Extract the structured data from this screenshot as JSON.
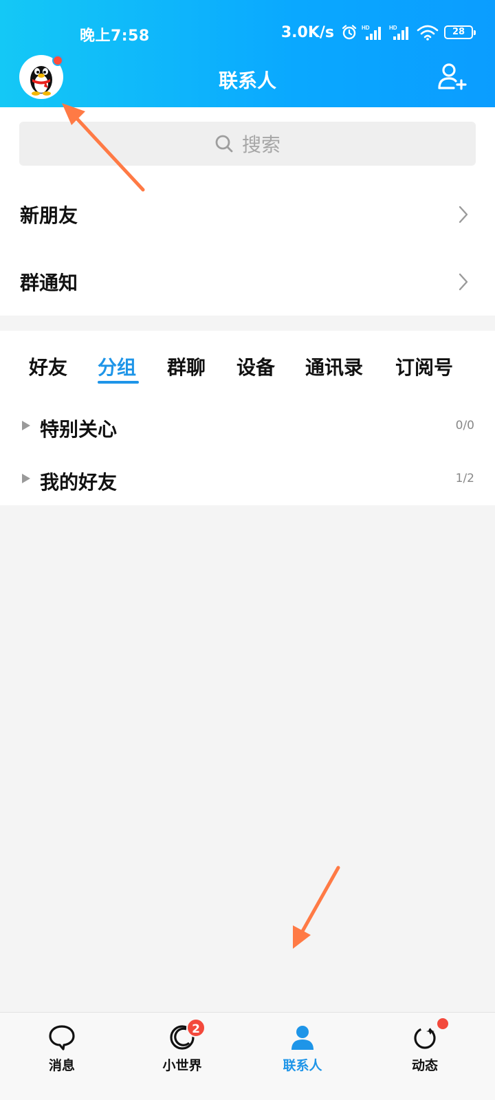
{
  "status_bar": {
    "time": "晚上7:58",
    "net_speed": "3.0K/s",
    "battery": "28",
    "hd_label": "HD"
  },
  "header": {
    "title": "联系人",
    "gradient_start": "#14c8f6",
    "gradient_end": "#0b9dff"
  },
  "search": {
    "placeholder": "搜索"
  },
  "menu": [
    {
      "label": "新朋友"
    },
    {
      "label": "群通知"
    }
  ],
  "tabs": [
    {
      "label": "好友",
      "active": false
    },
    {
      "label": "分组",
      "active": true
    },
    {
      "label": "群聊",
      "active": false
    },
    {
      "label": "设备",
      "active": false
    },
    {
      "label": "通讯录",
      "active": false
    },
    {
      "label": "订阅号",
      "active": false
    }
  ],
  "groups": [
    {
      "name": "特别关心",
      "count": "0/0"
    },
    {
      "name": "我的好友",
      "count": "1/2"
    }
  ],
  "bottom_nav": [
    {
      "label": "消息",
      "icon": "chat-bubble-icon",
      "active": false
    },
    {
      "label": "小世界",
      "icon": "world-ring-icon",
      "active": false,
      "badge": "2"
    },
    {
      "label": "联系人",
      "icon": "person-icon",
      "active": true
    },
    {
      "label": "动态",
      "icon": "star-orbit-icon",
      "active": false,
      "dot": true
    }
  ],
  "colors": {
    "accent": "#1e95e8",
    "badge": "#f3493c",
    "annotation_arrow": "#ff7a45"
  }
}
